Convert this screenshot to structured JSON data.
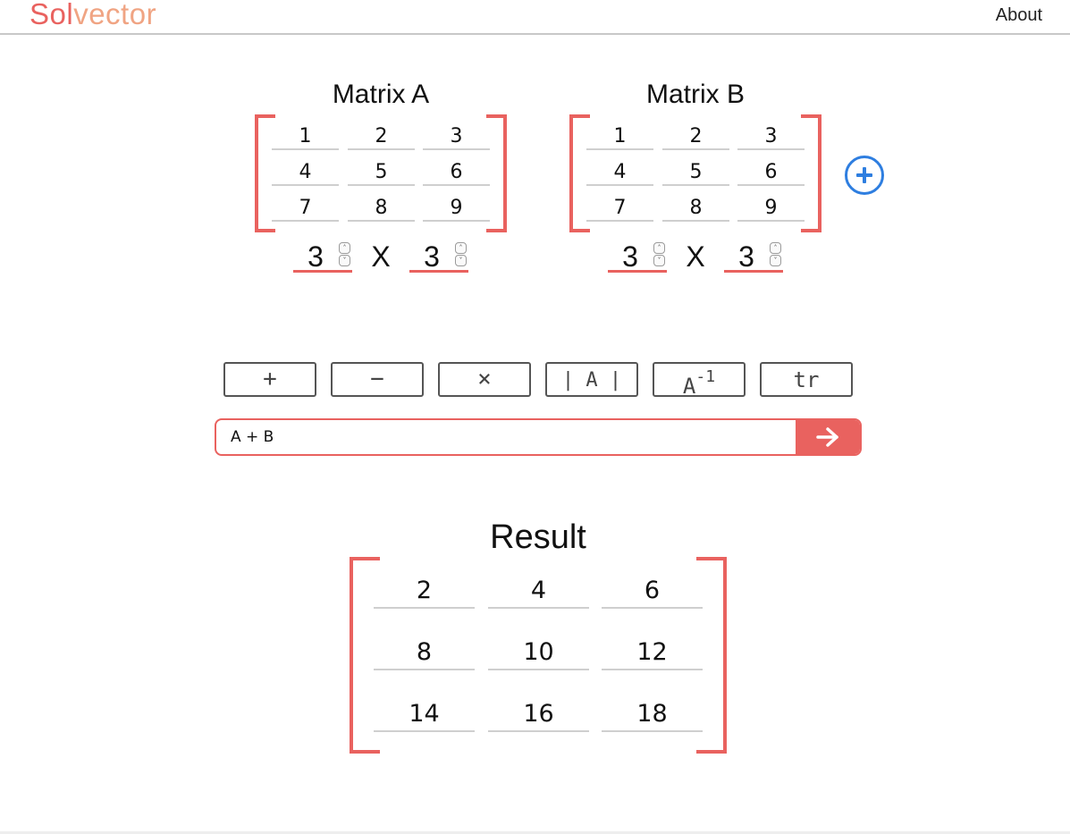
{
  "header": {
    "logo_part1": "Sol",
    "logo_part2": "vector",
    "about_label": "About"
  },
  "colors": {
    "accent": "#e9625f",
    "logo_secondary": "#f0a483",
    "add_button": "#2e7ee0",
    "button_border": "#555555"
  },
  "matrix_a": {
    "title": "Matrix A",
    "cells": [
      "1",
      "2",
      "3",
      "4",
      "5",
      "6",
      "7",
      "8",
      "9"
    ],
    "rows": "3",
    "cols": "3",
    "times_label": "X"
  },
  "matrix_b": {
    "title": "Matrix B",
    "cells": [
      "1",
      "2",
      "3",
      "4",
      "5",
      "6",
      "7",
      "8",
      "9"
    ],
    "rows": "3",
    "cols": "3",
    "times_label": "X"
  },
  "add_matrix_icon": "plus-circle-icon",
  "operations": [
    {
      "label": "+",
      "icon": "plus-icon"
    },
    {
      "label": "−",
      "icon": "minus-icon"
    },
    {
      "label": "×",
      "icon": "multiply-icon"
    },
    {
      "label": "| A |",
      "icon": "determinant-icon"
    },
    {
      "label": "A",
      "sup": "-1",
      "icon": "inverse-icon"
    },
    {
      "label": "tr",
      "icon": "trace-icon"
    }
  ],
  "expression": {
    "value": "A + B",
    "submit_icon": "arrow-right-icon"
  },
  "result": {
    "title": "Result",
    "cells": [
      "2",
      "4",
      "6",
      "8",
      "10",
      "12",
      "14",
      "16",
      "18"
    ]
  }
}
